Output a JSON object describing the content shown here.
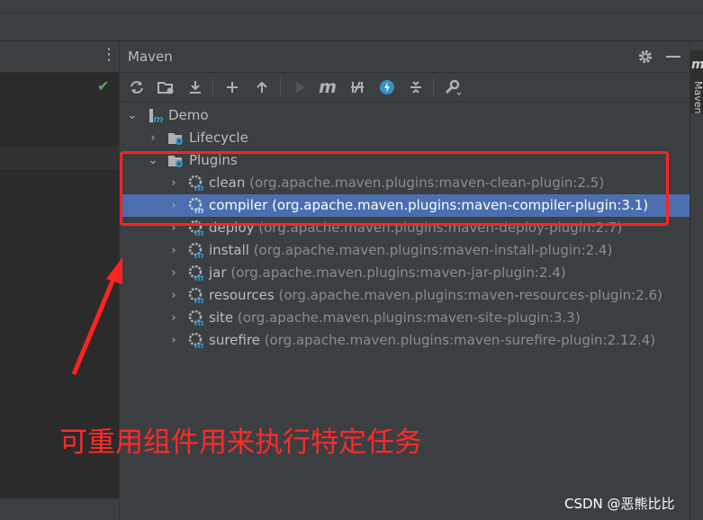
{
  "maven_panel": {
    "title": "Maven",
    "settings_icon": "gear-icon",
    "minimize_icon": "minus-icon",
    "side_tab_label": "Maven"
  },
  "toolbar": {
    "icons": [
      "reload-icon",
      "add-folder-icon",
      "download-icon",
      "plus-icon",
      "up-arrow-icon",
      "run-icon",
      "maven-m-icon",
      "toggle-offline-icon",
      "lightning-icon",
      "collapse-icon",
      "wrench-icon"
    ]
  },
  "tree": {
    "root": {
      "label": "Demo"
    },
    "lifecycle": {
      "label": "Lifecycle"
    },
    "plugins": {
      "label": "Plugins"
    },
    "plugin_items": [
      {
        "name": "clean",
        "detail": "(org.apache.maven.plugins:maven-clean-plugin:2.5)"
      },
      {
        "name": "compiler",
        "detail": "(org.apache.maven.plugins:maven-compiler-plugin:3.1)"
      },
      {
        "name": "deploy",
        "detail": "(org.apache.maven.plugins:maven-deploy-plugin:2.7)"
      },
      {
        "name": "install",
        "detail": "(org.apache.maven.plugins:maven-install-plugin:2.4)"
      },
      {
        "name": "jar",
        "detail": "(org.apache.maven.plugins:maven-jar-plugin:2.4)"
      },
      {
        "name": "resources",
        "detail": "(org.apache.maven.plugins:maven-resources-plugin:2.6)"
      },
      {
        "name": "site",
        "detail": "(org.apache.maven.plugins:maven-site-plugin:3.3)"
      },
      {
        "name": "surefire",
        "detail": "(org.apache.maven.plugins:maven-surefire-plugin:2.12.4)"
      }
    ],
    "selected_item": "compiler"
  },
  "annotation": {
    "text": "可重用组件用来执行特定任务",
    "color": "#ff2a2a"
  },
  "watermark": "CSDN @恶熊比比",
  "colors": {
    "selection": "#4b6eaf",
    "panel_bg": "#3c3f41",
    "highlight_red": "#ff2222"
  }
}
